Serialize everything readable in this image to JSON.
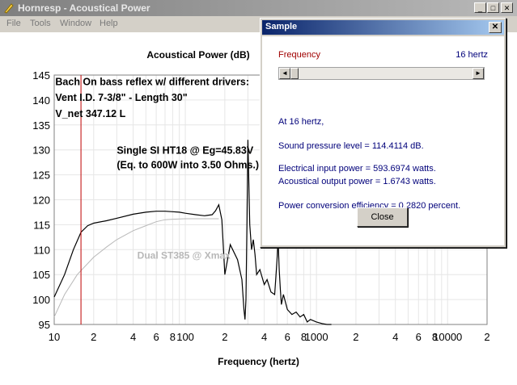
{
  "window": {
    "title": "Hornresp - Acoustical Power",
    "controls": {
      "minimize": "_",
      "maximize": "□",
      "close": "✕"
    }
  },
  "menu": [
    "File",
    "Tools",
    "Window",
    "Help"
  ],
  "chart_data": {
    "type": "line",
    "title": "Acoustical Power (dB)",
    "xlabel": "Frequency (hertz)",
    "xscale": "log",
    "xlim": [
      10,
      20000
    ],
    "ylim": [
      95,
      145
    ],
    "yticks": [
      95,
      100,
      105,
      110,
      115,
      120,
      125,
      130,
      135,
      140,
      145
    ],
    "xtick_labels": [
      {
        "x": 10,
        "label": "10"
      },
      {
        "x": 20,
        "label": "2"
      },
      {
        "x": 40,
        "label": "4"
      },
      {
        "x": 60,
        "label": "6"
      },
      {
        "x": 80,
        "label": "8"
      },
      {
        "x": 100,
        "label": "100"
      },
      {
        "x": 200,
        "label": "2"
      },
      {
        "x": 400,
        "label": "4"
      },
      {
        "x": 600,
        "label": "6"
      },
      {
        "x": 800,
        "label": "8"
      },
      {
        "x": 1000,
        "label": "1000"
      },
      {
        "x": 2000,
        "label": "2"
      },
      {
        "x": 4000,
        "label": "4"
      },
      {
        "x": 6000,
        "label": "6"
      },
      {
        "x": 8000,
        "label": "8"
      },
      {
        "x": 10000,
        "label": "10000"
      },
      {
        "x": 20000,
        "label": "2"
      }
    ],
    "grid": true,
    "marker_frequency": 16,
    "annotations": [
      {
        "text": "Bach On bass reflex w/ different drivers:",
        "x": 10.2,
        "y": 143
      },
      {
        "text": "Vent I.D. 7-3/8\" - Length 30\"",
        "x": 10.2,
        "y": 139.8
      },
      {
        "text": "V_net 347.12 L",
        "x": 10.2,
        "y": 136.6
      },
      {
        "text": "Single SI HT18 @ Eg=45.83V",
        "x": 30,
        "y": 129.2
      },
      {
        "text": "(Eq. to 600W into 3.50 Ohms.)",
        "x": 30,
        "y": 126.3
      }
    ],
    "series": [
      {
        "name": "Single SI HT18 @ Eg=45.83V",
        "color": "#000000",
        "x": [
          10,
          12,
          14,
          16,
          18,
          20,
          25,
          30,
          40,
          50,
          60,
          70,
          80,
          90,
          100,
          120,
          140,
          160,
          170,
          180,
          190,
          200,
          220,
          250,
          270,
          280,
          285,
          290,
          295,
          300,
          310,
          320,
          330,
          340,
          350,
          370,
          400,
          420,
          450,
          480,
          500,
          510,
          520,
          530,
          540,
          560,
          600,
          650,
          700,
          750,
          800,
          850,
          900,
          1000,
          1100,
          1200,
          1300
        ],
        "values": [
          100.5,
          105,
          110,
          113.5,
          114.8,
          115.3,
          115.8,
          116.3,
          117.1,
          117.5,
          117.7,
          117.7,
          117.6,
          117.5,
          117.3,
          117.0,
          116.8,
          117.0,
          117.8,
          119,
          116,
          105,
          111,
          108,
          104,
          98,
          96,
          100,
          115,
          132,
          115,
          110,
          112,
          109,
          105,
          106,
          103,
          104,
          101.5,
          101,
          108,
          112,
          106,
          102,
          99,
          101,
          98,
          97,
          97.5,
          96.5,
          97,
          95.5,
          96,
          95.5,
          95.2,
          95.0,
          95.0
        ]
      },
      {
        "name": "Dual ST385 @ Xmax",
        "color": "#b8b8b8",
        "x": [
          10,
          12,
          15,
          20,
          25,
          30,
          40,
          50,
          60,
          70,
          80,
          100,
          130,
          160,
          180
        ],
        "values": [
          96.5,
          101,
          105,
          108.5,
          110.5,
          112,
          113.8,
          114.8,
          115.6,
          116.0,
          116.1,
          116.2,
          116.2,
          116.2,
          116.2
        ]
      }
    ],
    "series_label": {
      "text": "Dual ST385 @ Xmax",
      "x": 43,
      "y": 108.2
    }
  },
  "dialog": {
    "title": "Sample",
    "close_glyph": "✕",
    "frequency_label": "Frequency",
    "frequency_value": "16 hertz",
    "slider_position": 0.0,
    "slider_left": "◄",
    "slider_right": "►",
    "lines": [
      "At 16 hertz,",
      "Sound pressure level = 114.4114 dB.",
      "Electrical input power = 593.6974 watts.",
      "Acoustical output power = 1.6743 watts.",
      "Power conversion efficiency = 0.2820 percent."
    ],
    "close_button": "Close"
  },
  "colors": {
    "marker_line": "#c00000",
    "grid": "#e6e6e6"
  }
}
